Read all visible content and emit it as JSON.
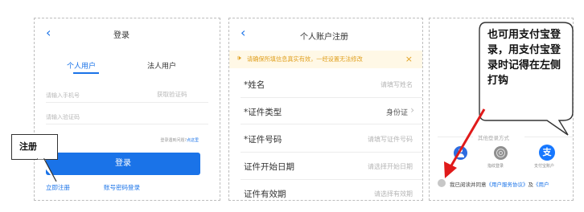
{
  "panel1": {
    "title": "登录",
    "tabs": [
      "个人用户",
      "法人用户"
    ],
    "phone_placeholder": "请输入手机号",
    "get_code": "获取验证码",
    "code_placeholder": "请输入验证码",
    "help_prefix": "登录遇到问题?",
    "help_link": "点这里",
    "login_button": "登录",
    "register_link": "立即注册",
    "password_login_link": "账号密码登录",
    "callout": "注册"
  },
  "panel2": {
    "title": "个人账户注册",
    "notice": "请确保所填信息真实有效，一经设置无法修改",
    "rows": [
      {
        "label": "*姓名",
        "value": "请填写姓名"
      },
      {
        "label": "*证件类型",
        "value": "身份证"
      },
      {
        "label": "*证件号码",
        "value": "请填写证件号码"
      },
      {
        "label": "证件开始日期",
        "value": "请选择开始日期"
      },
      {
        "label": "证件有效期",
        "value": "请选择有效期"
      }
    ]
  },
  "panel3": {
    "other_methods": "其他登录方式",
    "methods": [
      {
        "label": "",
        "icon": "person-icon"
      },
      {
        "label": "指纹登录",
        "icon": "fingerprint-icon"
      },
      {
        "label": "支付宝账户",
        "icon": "alipay-icon",
        "glyph": "支"
      }
    ],
    "agreement_prefix": "我已阅读并同意",
    "agreement_link1": "《用户服务协议》",
    "agreement_and": "及",
    "agreement_link2": "《用户",
    "callout": "也可用支付宝登录，用支付宝登录时记得在左侧打钩"
  },
  "colors": {
    "accent": "#1a73e8",
    "notice_bg": "#fff8e6",
    "notice_text": "#e0a020",
    "arrow": "#e01a1a"
  }
}
